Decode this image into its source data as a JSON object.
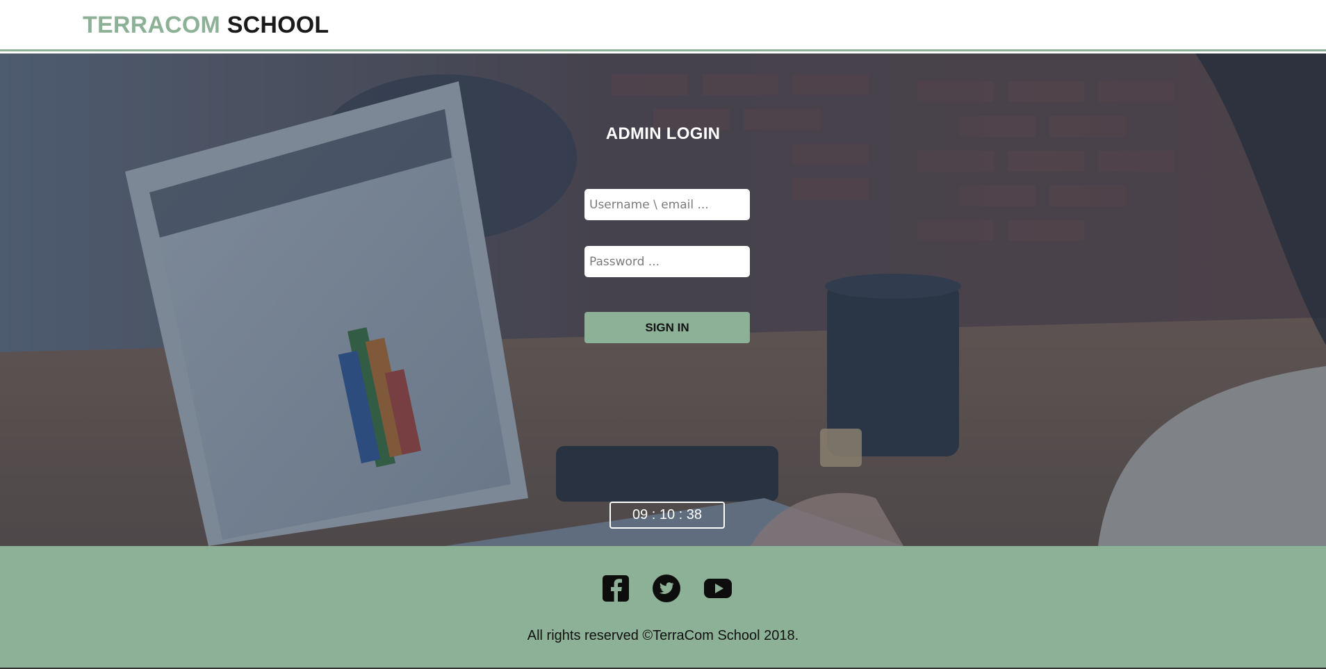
{
  "header": {
    "logo_part1": "TERRACOM",
    "logo_part2": "SCHOOL"
  },
  "login": {
    "title": "ADMIN LOGIN",
    "username_placeholder": "Username \\ email ...",
    "password_placeholder": "Password ...",
    "submit_label": "SIGN IN"
  },
  "clock": {
    "time": "09 : 10 : 38"
  },
  "footer": {
    "social": [
      "facebook-icon",
      "twitter-icon",
      "youtube-icon"
    ],
    "copyright": "All rights reserved ©TerraCom School 2018."
  },
  "colors": {
    "accent": "#8db196",
    "dark": "#1a1a1a",
    "overlay": "#28374e"
  }
}
